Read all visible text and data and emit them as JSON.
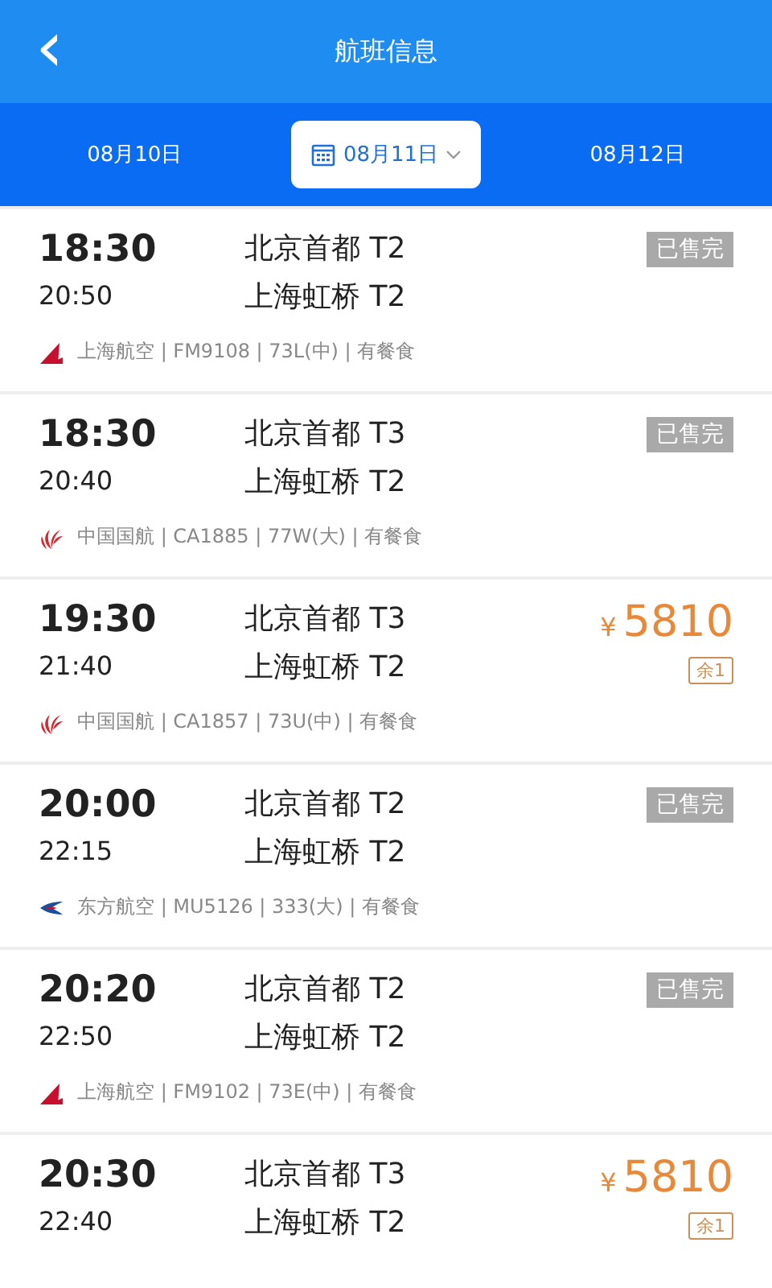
{
  "header": {
    "back_icon": "‹",
    "title": "航班信息"
  },
  "dates": [
    {
      "label": "08月10日",
      "selected": false
    },
    {
      "label": "08月11日",
      "selected": true
    },
    {
      "label": "08月12日",
      "selected": false
    }
  ],
  "flights": [
    {
      "depart": "18:30",
      "arrive": "20:50",
      "from": "北京首都 T2",
      "to": "上海虹桥 T2",
      "logo": {
        "kind": "wing"
      },
      "info": "上海航空 | FM9108 | 73L(中) | 有餐食",
      "kind": "sold_out",
      "status": "已售完"
    },
    {
      "depart": "18:30",
      "arrive": "20:40",
      "from": "北京首都 T3",
      "to": "上海虹桥 T2",
      "logo": {
        "kind": "phoenix"
      },
      "info": "中国国航 | CA1885 | 77W(大) | 有餐食",
      "kind": "sold_out",
      "status": "已售完"
    },
    {
      "depart": "19:30",
      "arrive": "21:40",
      "from": "北京首都 T3",
      "to": "上海虹桥 T2",
      "logo": {
        "kind": "phoenix"
      },
      "info": "中国国航 | CA1857 | 73U(中) | 有餐食",
      "kind": "price",
      "currency": "¥",
      "price": "5810",
      "remaining": "余1"
    },
    {
      "depart": "20:00",
      "arrive": "22:15",
      "from": "北京首都 T2",
      "to": "上海虹桥 T2",
      "logo": {
        "kind": "swallow"
      },
      "info": "东方航空 | MU5126 | 333(大) | 有餐食",
      "kind": "sold_out",
      "status": "已售完"
    },
    {
      "depart": "20:20",
      "arrive": "22:50",
      "from": "北京首都 T2",
      "to": "上海虹桥 T2",
      "logo": {
        "kind": "wing"
      },
      "info": "上海航空 | FM9102 | 73E(中) | 有餐食",
      "kind": "sold_out",
      "status": "已售完"
    },
    {
      "depart": "20:30",
      "arrive": "22:40",
      "from": "北京首都 T3",
      "to": "上海虹桥 T2",
      "kind": "price",
      "currency": "¥",
      "price": "5810",
      "remaining": "余1"
    }
  ]
}
